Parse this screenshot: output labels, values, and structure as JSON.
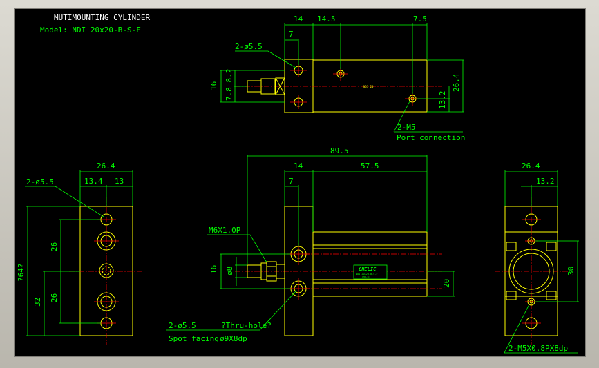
{
  "drawing": {
    "title": "MUTIMOUNTING CYLINDER",
    "model": "Model: NDI 20x20-B-S-F"
  },
  "top_view": {
    "dim_14": "14",
    "dim_14_5": "14.5",
    "dim_7_5": "7.5",
    "dim_7": "7",
    "hole_callout": "2-ø5.5",
    "dim_16": "16",
    "dim_7_8_2": "7.8 8.2",
    "dim_26_4": "26.4",
    "dim_13_2": "13.2",
    "port_callout": "2-M5",
    "port_note": "Port connection",
    "body_marking": "NDI 20"
  },
  "front_view": {
    "dim_89_5": "89.5",
    "dim_14": "14",
    "dim_57_5": "57.5",
    "dim_7": "7",
    "thread_callout": "M6X1.0P",
    "dim_16": "16",
    "dim_phi8": "ø8",
    "dim_20": "20",
    "hole_callout": "2-ø5.5",
    "hole_note": "?Thru-hole?",
    "spot_label": "Spot facing",
    "spot_value": "ø9X8dp",
    "brand": "CHELIC",
    "brand_sub": "NDI 20X20-B-S-F",
    "brand_sub2": "CHELIC"
  },
  "left_view": {
    "dim_26_4": "26.4",
    "dim_13_4": "13.4",
    "dim_13": "13",
    "hole_callout": "2-ø5.5",
    "dim_26_top": "26",
    "dim_26_bot": "26",
    "dim_32": "32",
    "dim_overall": "?64?"
  },
  "right_view": {
    "dim_26_4": "26.4",
    "dim_13_2": "13.2",
    "dim_30": "30",
    "port_callout": "2-M5X0.8PX8dp"
  }
}
